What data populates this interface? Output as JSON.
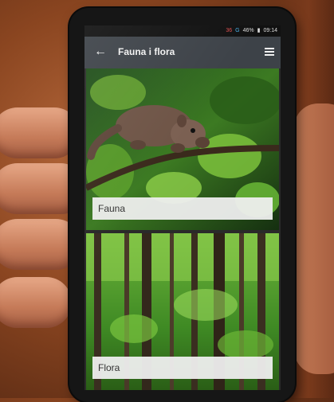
{
  "statusbar": {
    "battery_text": "46%",
    "time": "09:14",
    "network_red": "36",
    "network_blue": "G"
  },
  "appbar": {
    "title": "Fauna i flora",
    "back_icon": "arrow-left-icon",
    "menu_icon": "menu-icon"
  },
  "cards": [
    {
      "label": "Fauna",
      "image": "squirrel-in-tree"
    },
    {
      "label": "Flora",
      "image": "forest"
    }
  ],
  "colors": {
    "appbar": "#3d4248",
    "label_bg": "#eeeeee",
    "label_text": "#333333"
  }
}
